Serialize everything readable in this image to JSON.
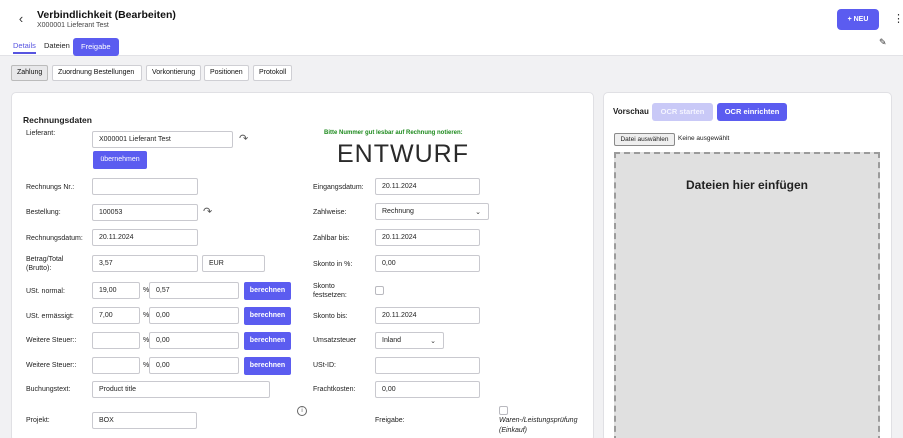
{
  "header": {
    "back_icon": "chevron-left-icon",
    "title": "Verbindlichkeit (Bearbeiten)",
    "subtitle": "X000001 Lieferant Test",
    "new_button": "+ NEU",
    "tabs": [
      "Details",
      "Dateien",
      "Freigabe"
    ]
  },
  "subtabs": [
    "Zahlung",
    "Zuordnung Bestellungen",
    "Vorkontierung",
    "Positionen",
    "Protokoll"
  ],
  "form": {
    "section_title": "Rechnungsdaten",
    "hint": "Bitte Nummer gut lesbar auf Rechnung notieren:",
    "watermark": "ENTWURF",
    "accent_color": "#5b5cf0",
    "hint_color": "#1d8a1d",
    "left": {
      "lieferant_label": "Lieferant:",
      "lieferant_value": "X000001 Lieferant Test",
      "uebernehmen_button": "übernehmen",
      "rechnungs_nr_label": "Rechnungs Nr.:",
      "rechnungs_nr_value": "",
      "bestellung_label": "Bestellung:",
      "bestellung_value": "100053",
      "rechnungsdatum_label": "Rechnungsdatum:",
      "rechnungsdatum_value": "20.11.2024",
      "betrag_label_1": "Betrag/Total",
      "betrag_label_2": "(Brutto):",
      "betrag_value": "3,57",
      "currency_value": "EUR",
      "ust_normal_label": "USt. normal:",
      "ust_normal_pct": "19,00",
      "ust_normal_amount": "0,57",
      "ust_ermaessigt_label": "USt. ermässigt:",
      "ust_ermaessigt_pct": "7,00",
      "ust_ermaessigt_amount": "0,00",
      "weitere1_label": "Weitere Steuer::",
      "weitere1_pct": "",
      "weitere1_amount": "0,00",
      "weitere2_label": "Weitere Steuer::",
      "weitere2_pct": "",
      "weitere2_amount": "0,00",
      "percent_sign": "%",
      "berechnen_button": "berechnen",
      "buchungstext_label": "Buchungstext:",
      "buchungstext_value": "Product title",
      "projekt_label": "Projekt:",
      "projekt_value": "BOX"
    },
    "right": {
      "eingangsdatum_label": "Eingangsdatum:",
      "eingangsdatum_value": "20.11.2024",
      "zahlweise_label": "Zahlweise:",
      "zahlweise_value": "Rechnung",
      "zahlbar_bis_label": "Zahlbar bis:",
      "zahlbar_bis_value": "20.11.2024",
      "skonto_pct_label": "Skonto in %:",
      "skonto_pct_value": "0,00",
      "skonto_festsetzen_label_1": "Skonto",
      "skonto_festsetzen_label_2": "festsetzen:",
      "skonto_bis_label": "Skonto bis:",
      "skonto_bis_value": "20.11.2024",
      "umsatzsteuer_label": "Umsatzsteuer",
      "umsatzsteuer_value": "Inland",
      "ust_id_label": "USt-ID:",
      "ust_id_value": "",
      "frachtkosten_label": "Frachtkosten:",
      "frachtkosten_value": "0,00",
      "freigabe_label": "Freigabe:",
      "pruefung_label_1": "Waren-/Leistungsprüfung",
      "pruefung_label_2": "(Einkauf)"
    }
  },
  "preview": {
    "title": "Vorschau",
    "ocr_start_button": "OCR starten",
    "ocr_setup_button": "OCR einrichten",
    "file_button": "Datei auswählen",
    "file_status": "Keine ausgewählt",
    "dropzone_text": "Dateien hier einfügen"
  }
}
